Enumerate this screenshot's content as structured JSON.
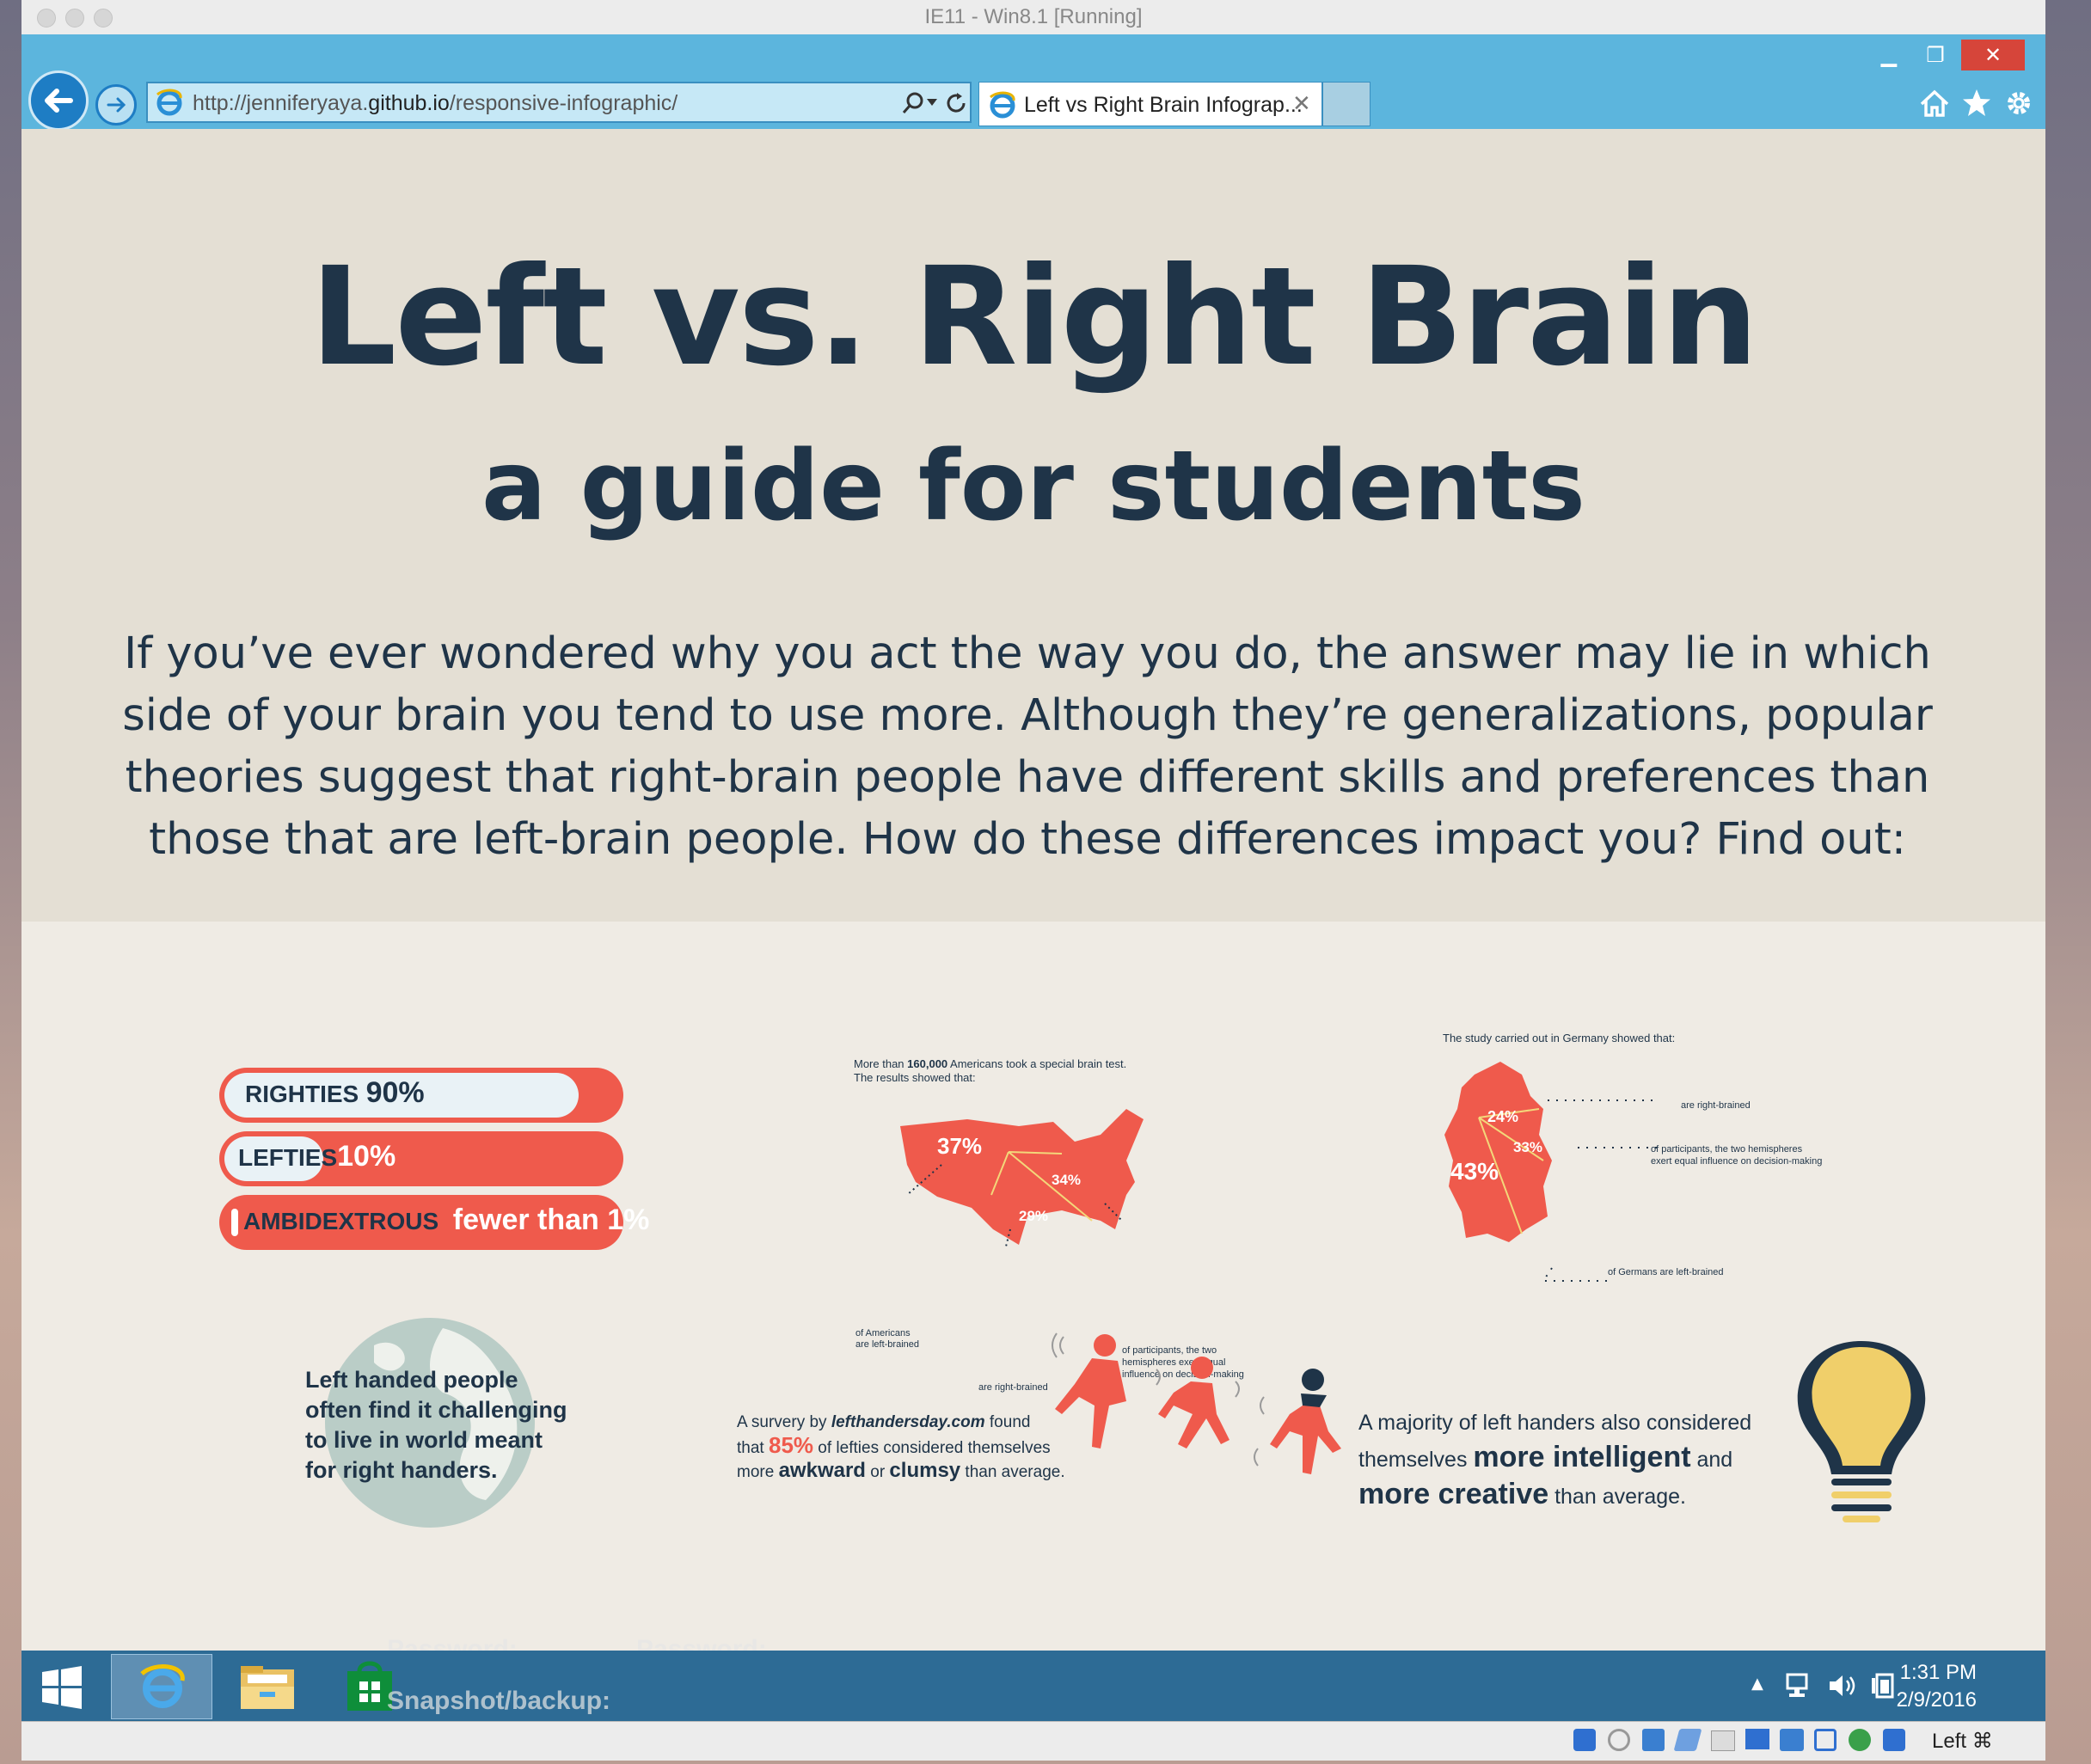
{
  "window": {
    "title": "IE11 - Win8.1 [Running]"
  },
  "browser": {
    "url_prefix": "http://jenniferyaya.",
    "url_domain": "github.io",
    "url_suffix": "/responsive-infographic/",
    "tab_title": "Left vs Right Brain Infograp...",
    "icons": [
      "back-arrow-icon",
      "forward-arrow-icon",
      "search-icon",
      "refresh-icon",
      "home-icon",
      "favorites-star-icon",
      "settings-gear-icon",
      "close-tab-icon"
    ]
  },
  "hero": {
    "title": "Left vs. Right Brain",
    "subtitle": "a guide for students",
    "intro_lines": [
      "If you’ve ever wondered why you act the way you do, the answer may lie in which",
      "side of your brain you tend to use more. Although they’re generalizations, popular",
      "theories suggest that right-brain people have different skills and preferences than",
      "those that are left-brain people. How do these differences impact you? Find out:"
    ]
  },
  "handedness": {
    "righties": {
      "label": "RIGHTIES",
      "value": "90%",
      "fraction": 0.9
    },
    "lefties": {
      "label": "LEFTIES",
      "value": "10%",
      "fraction": 0.25
    },
    "ambidextrous": {
      "label": "AMBIDEXTROUS",
      "value": "fewer than 1%",
      "fraction": 0.01
    }
  },
  "usa": {
    "intro_a": "More than ",
    "intro_b": "160,000",
    "intro_c": " Americans took a special brain test.",
    "intro_2": "The results showed that:",
    "p1": "37%",
    "p2": "34%",
    "p3": "29%",
    "left_label_1": "of Americans",
    "left_label_2": "are left-brained",
    "right_brained": "are right-brained",
    "equal_1": "of participants, the two",
    "equal_2": "hemispheres exert equal",
    "equal_3": "influence on decision-making"
  },
  "germany": {
    "intro": "The study carried out in Germany showed that:",
    "p1": "24%",
    "p2": "33%",
    "p3": "43%",
    "right_brained": "are right-brained",
    "equal_1": "of participants, the two hemispheres",
    "equal_2": "exert equal influence on decision-making",
    "left_brained": "of Germans are left-brained"
  },
  "globe": {
    "lines": [
      "Left handed people",
      "often find it challenging",
      "to live in world meant",
      "for right handers."
    ]
  },
  "survey": {
    "a": "A survery by ",
    "site": "lefthandersday.com",
    "b": " found",
    "c": "that ",
    "pct": "85%",
    "d": " of lefties considered themselves",
    "e": "more ",
    "awkward": "awkward",
    "f": " or ",
    "clumsy": "clumsy",
    "g": " than average."
  },
  "majority": {
    "a": "A majority of left handers also considered",
    "b": "themselves ",
    "intelligent": "more intelligent",
    "c": " and",
    "creative": "more creative",
    "d": " than average."
  },
  "ghost_text": {
    "password_1": "Password:",
    "password_2": "Password:",
    "snapshot": "Snapshot/backup:"
  },
  "taskbar": {
    "time": "1:31 PM",
    "date": "2/9/2016"
  },
  "status": {
    "host_key": "Left ⌘"
  },
  "colors": {
    "navy": "#1f3448",
    "coral": "#ef5a4c",
    "ie_blue": "#5cb5dd",
    "taskbar": "#2d6b95"
  }
}
